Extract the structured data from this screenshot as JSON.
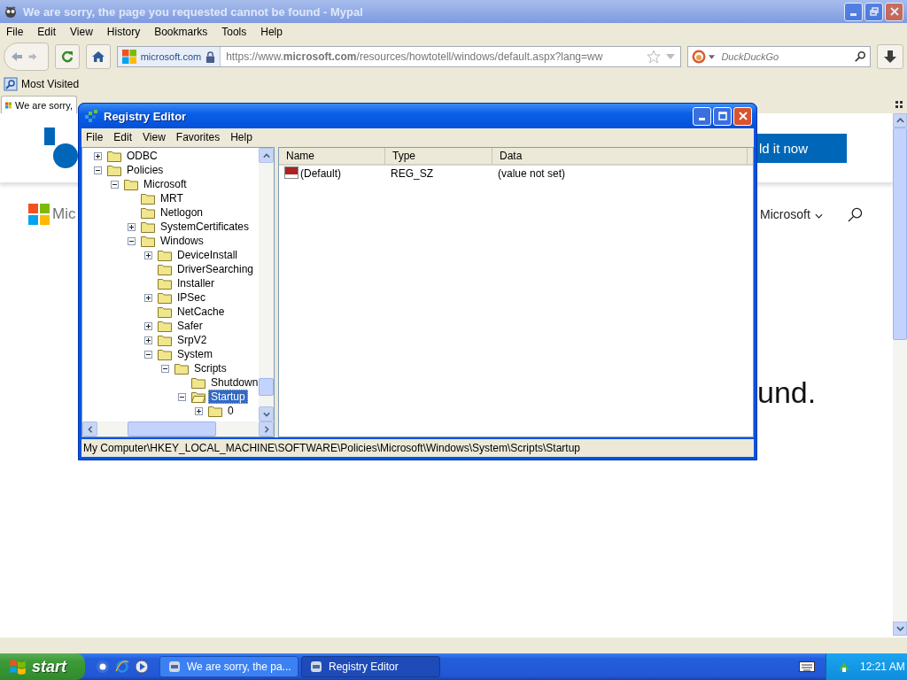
{
  "browser": {
    "title": "We are sorry, the page you requested cannot be found - Mypal",
    "menu": [
      "File",
      "Edit",
      "View",
      "History",
      "Bookmarks",
      "Tools",
      "Help"
    ],
    "identity": "microsoft.com",
    "url": "https://www.**microsoft.com**/resources/howtotell/windows/default.aspx?lang=ww",
    "search": {
      "placeholder": "DuckDuckGo"
    },
    "bookmarks": [
      "Most Visited"
    ],
    "tabs": [
      {
        "label": "We are sorry,",
        "selected": true
      }
    ],
    "page": {
      "header_button": "ld it now",
      "brand_text": "Mic",
      "nav_link": "Microsoft",
      "heading": "und."
    }
  },
  "registry": {
    "title": "Registry Editor",
    "menu": [
      "File",
      "Edit",
      "View",
      "Favorites",
      "Help"
    ],
    "tree": [
      {
        "label": "ODBC",
        "has_children": true,
        "expanded": false,
        "selected": false
      },
      {
        "label": "Policies",
        "has_children": true,
        "expanded": true,
        "selected": false,
        "children": [
          {
            "label": "Microsoft",
            "has_children": true,
            "expanded": true,
            "selected": false,
            "children": [
              {
                "label": "MRT",
                "has_children": false,
                "selected": false
              },
              {
                "label": "Netlogon",
                "has_children": false,
                "selected": false
              },
              {
                "label": "SystemCertificates",
                "has_children": true,
                "expanded": false,
                "selected": false
              },
              {
                "label": "Windows",
                "has_children": true,
                "expanded": true,
                "selected": false,
                "children": [
                  {
                    "label": "DeviceInstall",
                    "has_children": true,
                    "expanded": false,
                    "selected": false
                  },
                  {
                    "label": "DriverSearching",
                    "has_children": false,
                    "selected": false
                  },
                  {
                    "label": "Installer",
                    "has_children": false,
                    "selected": false
                  },
                  {
                    "label": "IPSec",
                    "has_children": true,
                    "expanded": false,
                    "selected": false
                  },
                  {
                    "label": "NetCache",
                    "has_children": false,
                    "selected": false
                  },
                  {
                    "label": "Safer",
                    "has_children": true,
                    "expanded": false,
                    "selected": false
                  },
                  {
                    "label": "SrpV2",
                    "has_children": true,
                    "expanded": false,
                    "selected": false
                  },
                  {
                    "label": "System",
                    "has_children": true,
                    "expanded": true,
                    "selected": false,
                    "children": [
                      {
                        "label": "Scripts",
                        "has_children": true,
                        "expanded": true,
                        "selected": false,
                        "children": [
                          {
                            "label": "Shutdown",
                            "has_children": false,
                            "selected": false
                          },
                          {
                            "label": "Startup",
                            "has_children": true,
                            "expanded": true,
                            "selected": true,
                            "children": [
                              {
                                "label": "0",
                                "has_children": true,
                                "expanded": false,
                                "selected": false
                              }
                            ]
                          }
                        ]
                      }
                    ]
                  }
                ]
              }
            ]
          }
        ]
      }
    ],
    "columns": [
      "Name",
      "Type",
      "Data"
    ],
    "values": [
      {
        "name": "(Default)",
        "type": "REG_SZ",
        "data": "(value not set)"
      }
    ],
    "status_bar": "My Computer\\HKEY_LOCAL_MACHINE\\SOFTWARE\\Policies\\Microsoft\\Windows\\System\\Scripts\\Startup"
  },
  "taskbar": {
    "start": "start",
    "tasks": [
      {
        "label": "We are sorry, the pa...",
        "selected": false
      },
      {
        "label": "Registry Editor",
        "selected": true
      }
    ],
    "clock": "12:21 AM"
  }
}
